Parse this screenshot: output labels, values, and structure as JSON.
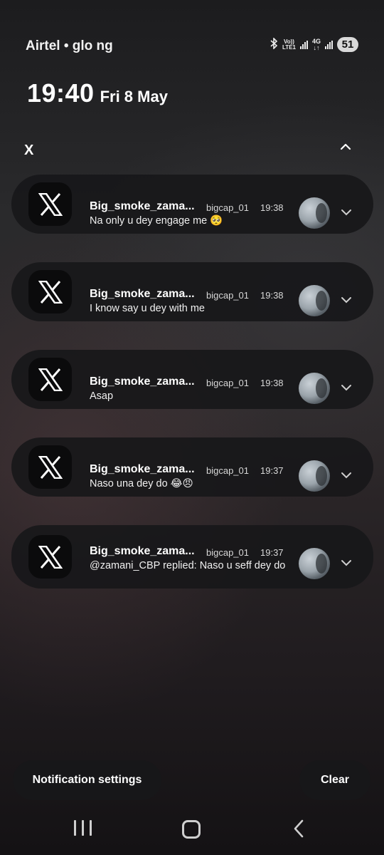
{
  "status_bar": {
    "carrier": "Airtel • glo ng",
    "volte_top": "Vo))",
    "volte_bottom": "LTE1",
    "net_top": "4G",
    "net_bottom": "↓↑",
    "battery": "51",
    "icons": [
      "bluetooth-icon",
      "signal-icon",
      "signal-icon",
      "battery-icon"
    ]
  },
  "clock": {
    "time": "19:40",
    "date": "Fri 8 May"
  },
  "app_group": {
    "name": "X",
    "collapse_icon": "chevron-up-icon"
  },
  "notifications": [
    {
      "title": "Big_smoke_zama...",
      "handle": "bigcap_01",
      "time": "19:38",
      "message": "Na only u dey engage me 🥺"
    },
    {
      "title": "Big_smoke_zama...",
      "handle": "bigcap_01",
      "time": "19:38",
      "message": "I know say u dey with me"
    },
    {
      "title": "Big_smoke_zama...",
      "handle": "bigcap_01",
      "time": "19:38",
      "message": "Asap"
    },
    {
      "title": "Big_smoke_zama...",
      "handle": "bigcap_01",
      "time": "19:37",
      "message": "Naso una dey do 😂😠"
    },
    {
      "title": "Big_smoke_zama...",
      "handle": "bigcap_01",
      "time": "19:37",
      "message": "@zamani_CBP replied: Naso u seff dey do"
    }
  ],
  "buttons": {
    "settings": "Notification settings",
    "clear": "Clear"
  },
  "nav_bar": {
    "icons": [
      "recents-icon",
      "home-icon",
      "back-icon"
    ]
  },
  "colors": {
    "card": "#18181a",
    "icon_bg": "#0b0b0c",
    "text": "#ffffff",
    "secondary_text": "#d8d8d8"
  }
}
